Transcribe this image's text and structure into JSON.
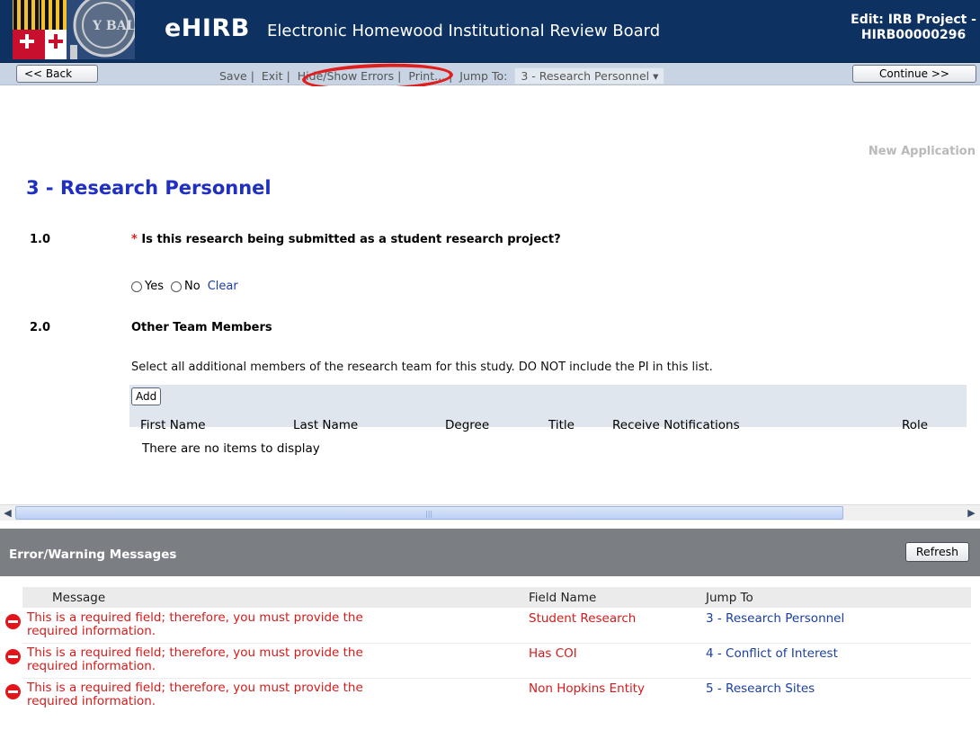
{
  "header": {
    "app_name": "eHIRB",
    "app_full_name": "Electronic Homewood Institutional Review Board",
    "edit_line1": "Edit: IRB Project -",
    "edit_line2": "HIRB00000296"
  },
  "toolbar": {
    "back_label": "<< Back",
    "save_label": "Save",
    "exit_label": "Exit",
    "hide_show_errors_label": "Hide/Show Errors",
    "print_label": "Print...",
    "jump_to_label": "Jump To:",
    "jump_to_value": "3 - Research Personnel",
    "continue_label": "Continue >>"
  },
  "content": {
    "status": "New Application",
    "section_title": "3 - Research Personnel",
    "q1": {
      "number": "1.0",
      "required_mark": "*",
      "text": "Is this research being submitted as a student research project?",
      "options": [
        "Yes",
        "No"
      ],
      "clear_label": "Clear"
    },
    "q2": {
      "number": "2.0",
      "title": "Other Team Members",
      "description": "Select all additional members of the research team for this study. DO NOT include the PI in this list.",
      "add_label": "Add",
      "columns": [
        "First Name",
        "Last Name",
        "Degree",
        "Title",
        "Receive Notifications",
        "Role"
      ],
      "empty_text": "There are no items to display"
    }
  },
  "errors": {
    "title": "Error/Warning Messages",
    "refresh_label": "Refresh",
    "columns": [
      "Message",
      "Field Name",
      "Jump To"
    ],
    "rows": [
      {
        "message_line1": "This is a required field; therefore, you must provide the",
        "message_line2": "required information.",
        "field": "Student Research",
        "jump": "3 - Research Personnel"
      },
      {
        "message_line1": "This is a required field; therefore, you must provide the",
        "message_line2": "required information.",
        "field": "Has COI",
        "jump": "4 - Conflict of Interest"
      },
      {
        "message_line1": "This is a required field; therefore, you must provide the",
        "message_line2": "required information.",
        "field": "Non Hopkins Entity",
        "jump": "5 - Research Sites"
      }
    ]
  },
  "colors": {
    "header_bg": "#0d3161",
    "toolbar_bg": "#c8d4e3",
    "title_blue": "#1f2ec3",
    "error_red": "#d61a1a",
    "annotation_red": "#e01e1e",
    "panel_gray": "#7b7f84"
  },
  "icons": {
    "seal": "university-seal",
    "error": "error-circle-icon",
    "scroll_left": "scroll-left-icon",
    "scroll_right": "scroll-right-icon",
    "dropdown": "dropdown-arrow-icon"
  }
}
